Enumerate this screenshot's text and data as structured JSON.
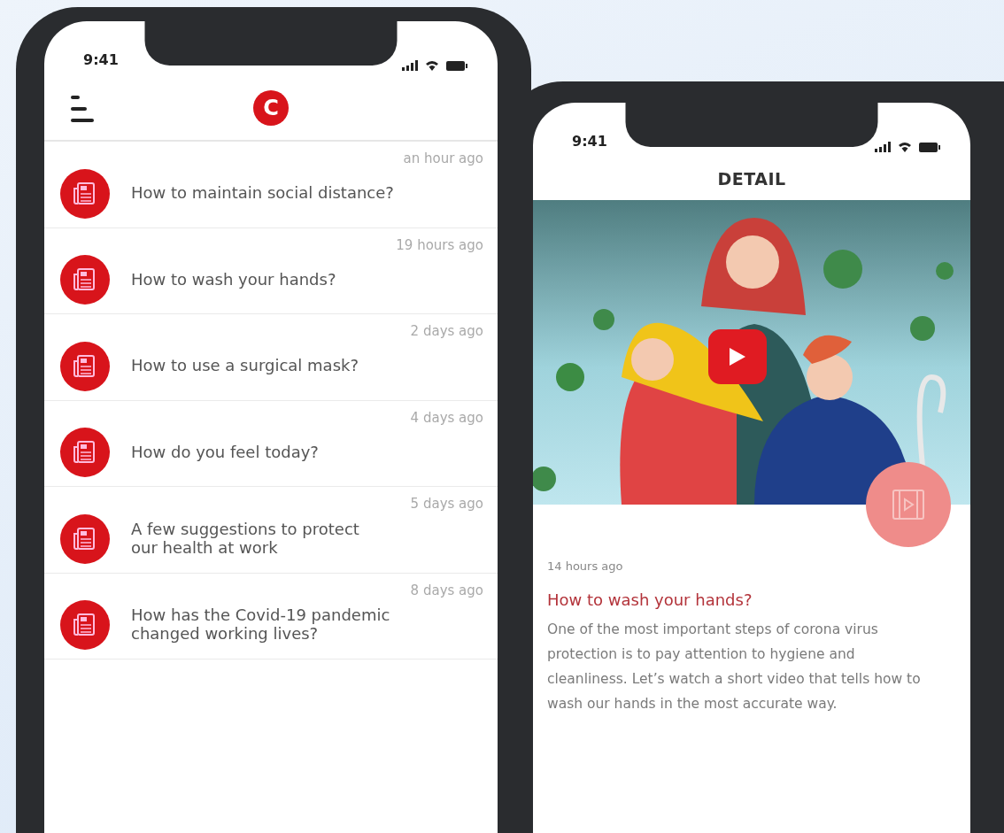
{
  "list_screen": {
    "status_bar": {
      "time": "9:41"
    },
    "logo": "C",
    "items": [
      {
        "time": "an hour ago",
        "title": "How to maintain social distance?"
      },
      {
        "time": "19 hours ago",
        "title": "How to wash your hands?"
      },
      {
        "time": "2 days ago",
        "title": "How to use a surgical mask?"
      },
      {
        "time": "4 days ago",
        "title": "How do you feel today?"
      },
      {
        "time": "5 days ago",
        "title": "A few suggestions to protect\nour health at work"
      },
      {
        "time": "8 days ago",
        "title": "How has the Covid-19 pandemic\nchanged working lives?"
      }
    ]
  },
  "detail_screen": {
    "status_bar": {
      "time": "9:41"
    },
    "title": "DETAIL",
    "time": "14 hours ago",
    "heading": "How to wash your hands?",
    "body": "One of the most important steps of corona virus protection is to pay attention to hygiene and cleanliness. Let’s watch a short video that tells how to wash our hands in the most accurate way."
  }
}
